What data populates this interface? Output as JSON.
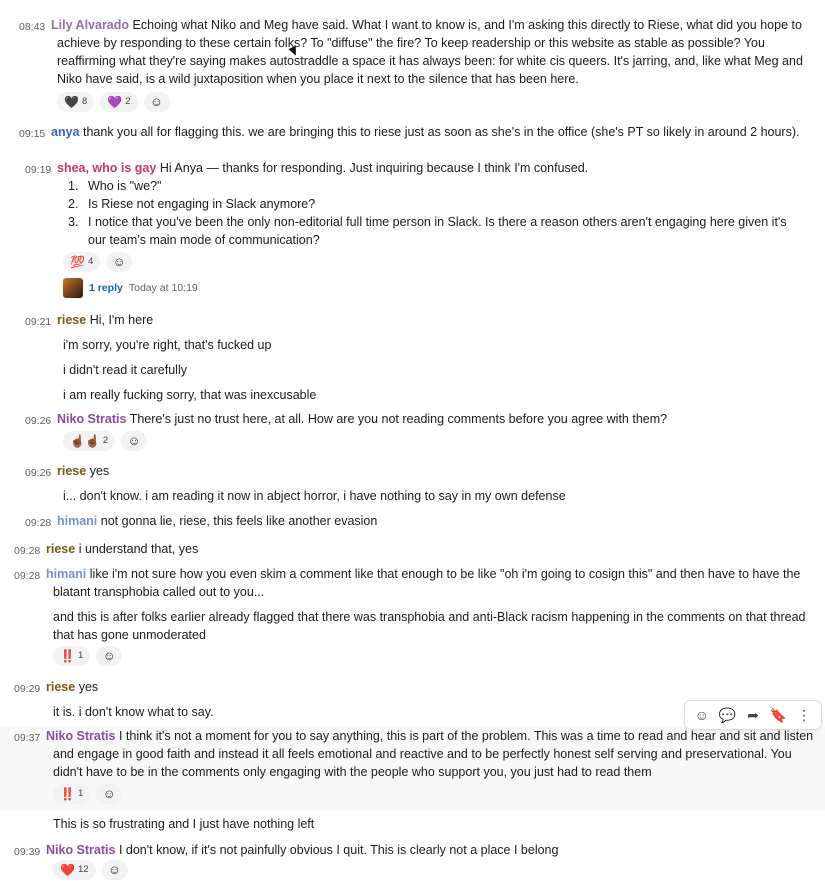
{
  "messages": [
    {
      "id": "m1",
      "time": "08:43",
      "author": "Lily Alvarado",
      "text": "Echoing what Niko and Meg have said. What I want to know is, and I'm asking this directly to Riese, what did you hope to achieve by responding to these certain folks? To \"diffuse\" the fire? To keep readership or this website as stable as possible? You reaffirming what they're saying makes autostraddle a space it has always been: for white cis queers. It's jarring, and, like what Meg and Niko have said, is a wild juxtaposition when you place it next to the silence that has been here.",
      "reactions": [
        {
          "emoji": "🖤",
          "count": "8"
        },
        {
          "emoji": "💜",
          "count": "2"
        }
      ]
    },
    {
      "id": "m2",
      "time": "09:15",
      "author": "anya",
      "text": "thank you all for flagging this. we are bringing this to riese just as soon as she's in the office (she's PT so likely in around 2 hours)."
    },
    {
      "id": "m3",
      "time": "09:19",
      "author": "shea, who is gay",
      "text": "Hi Anya — thanks for responding. Just inquiring because I think I'm confused.",
      "list": [
        {
          "num": "1.",
          "text": "Who is \"we?\""
        },
        {
          "num": "2.",
          "text": "Is Riese not engaging in Slack anymore?"
        },
        {
          "num": "3.",
          "text": "I notice that you've been the only non-editorial full time person in Slack. Is there a reason others aren't engaging here given it's our team's main mode of communication?"
        }
      ],
      "reactions": [
        {
          "emoji": "💯",
          "count": "4"
        }
      ],
      "thread": {
        "replies": "1 reply",
        "time": "Today at 10:19"
      }
    },
    {
      "id": "m4",
      "time": "09:21",
      "author": "riese",
      "text": "Hi, I'm here",
      "continuations": [
        "i'm sorry, you're right, that's fucked up",
        "i didn't read it carefully",
        "i am really fucking sorry, that was inexcusable"
      ]
    },
    {
      "id": "m5",
      "time": "09:26",
      "author": "Niko Stratis",
      "text": "There's just no trust here, at all. How are you not reading comments before you agree with them?",
      "reactions": [
        {
          "emoji": "☝🏾☝🏾",
          "count": "2"
        }
      ]
    },
    {
      "id": "m6",
      "time": "09:26",
      "author": "riese",
      "text": "yes",
      "continuations": [
        "i... don't know. i am reading it now in abject horror, i have nothing to say in my own defense"
      ]
    },
    {
      "id": "m7",
      "time": "09:28",
      "author": "himani",
      "text": "not gonna lie, riese, this feels like another evasion"
    },
    {
      "id": "m8",
      "time": "09:28",
      "author": "riese",
      "text": "i understand that, yes"
    },
    {
      "id": "m9",
      "time": "09:28",
      "author": "himani",
      "text": "like i'm not sure how you even skim a comment like that enough to be like \"oh i'm going to cosign this\" and then have to have the blatant transphobia called out to you...",
      "continuations": [
        "and this is after folks earlier already flagged that there was transphobia and anti-Black racism happening in the comments on that thread that has gone unmoderated"
      ],
      "reactions": [
        {
          "emoji": "‼️",
          "count": "1"
        }
      ]
    },
    {
      "id": "m10",
      "time": "09:29",
      "author": "riese",
      "text": "yes",
      "continuations": [
        "it is. i don't know what to say."
      ]
    },
    {
      "id": "m11",
      "time": "09:37",
      "author": "Niko Stratis",
      "text": "I think it's not a moment for you to say anything, this is part of the problem. This was a time to read and hear and sit and listen and engage in good faith and instead it all feels emotional and reactive and to be perfectly honest self serving and preservational. You didn't have to be in the comments only engaging with the people who support you, you just had to read them",
      "reactions": [
        {
          "emoji": "‼️",
          "count": "1"
        }
      ],
      "continuations": [
        "This is so frustrating and I just have nothing left"
      ]
    },
    {
      "id": "m12",
      "time": "09:39",
      "author": "Niko Stratis",
      "text": "I don't know, if it's not painfully obvious I quit. This is clearly not a place I belong",
      "reactions": [
        {
          "emoji": "❤️",
          "count": "12"
        }
      ]
    }
  ],
  "toolbar": {
    "icons": [
      "add-reaction-icon",
      "reply-in-thread-icon",
      "share-icon",
      "bookmark-icon",
      "more-actions-icon"
    ],
    "glyphs": [
      "☺",
      "💬",
      "➦",
      "🔖",
      "⋮"
    ]
  }
}
